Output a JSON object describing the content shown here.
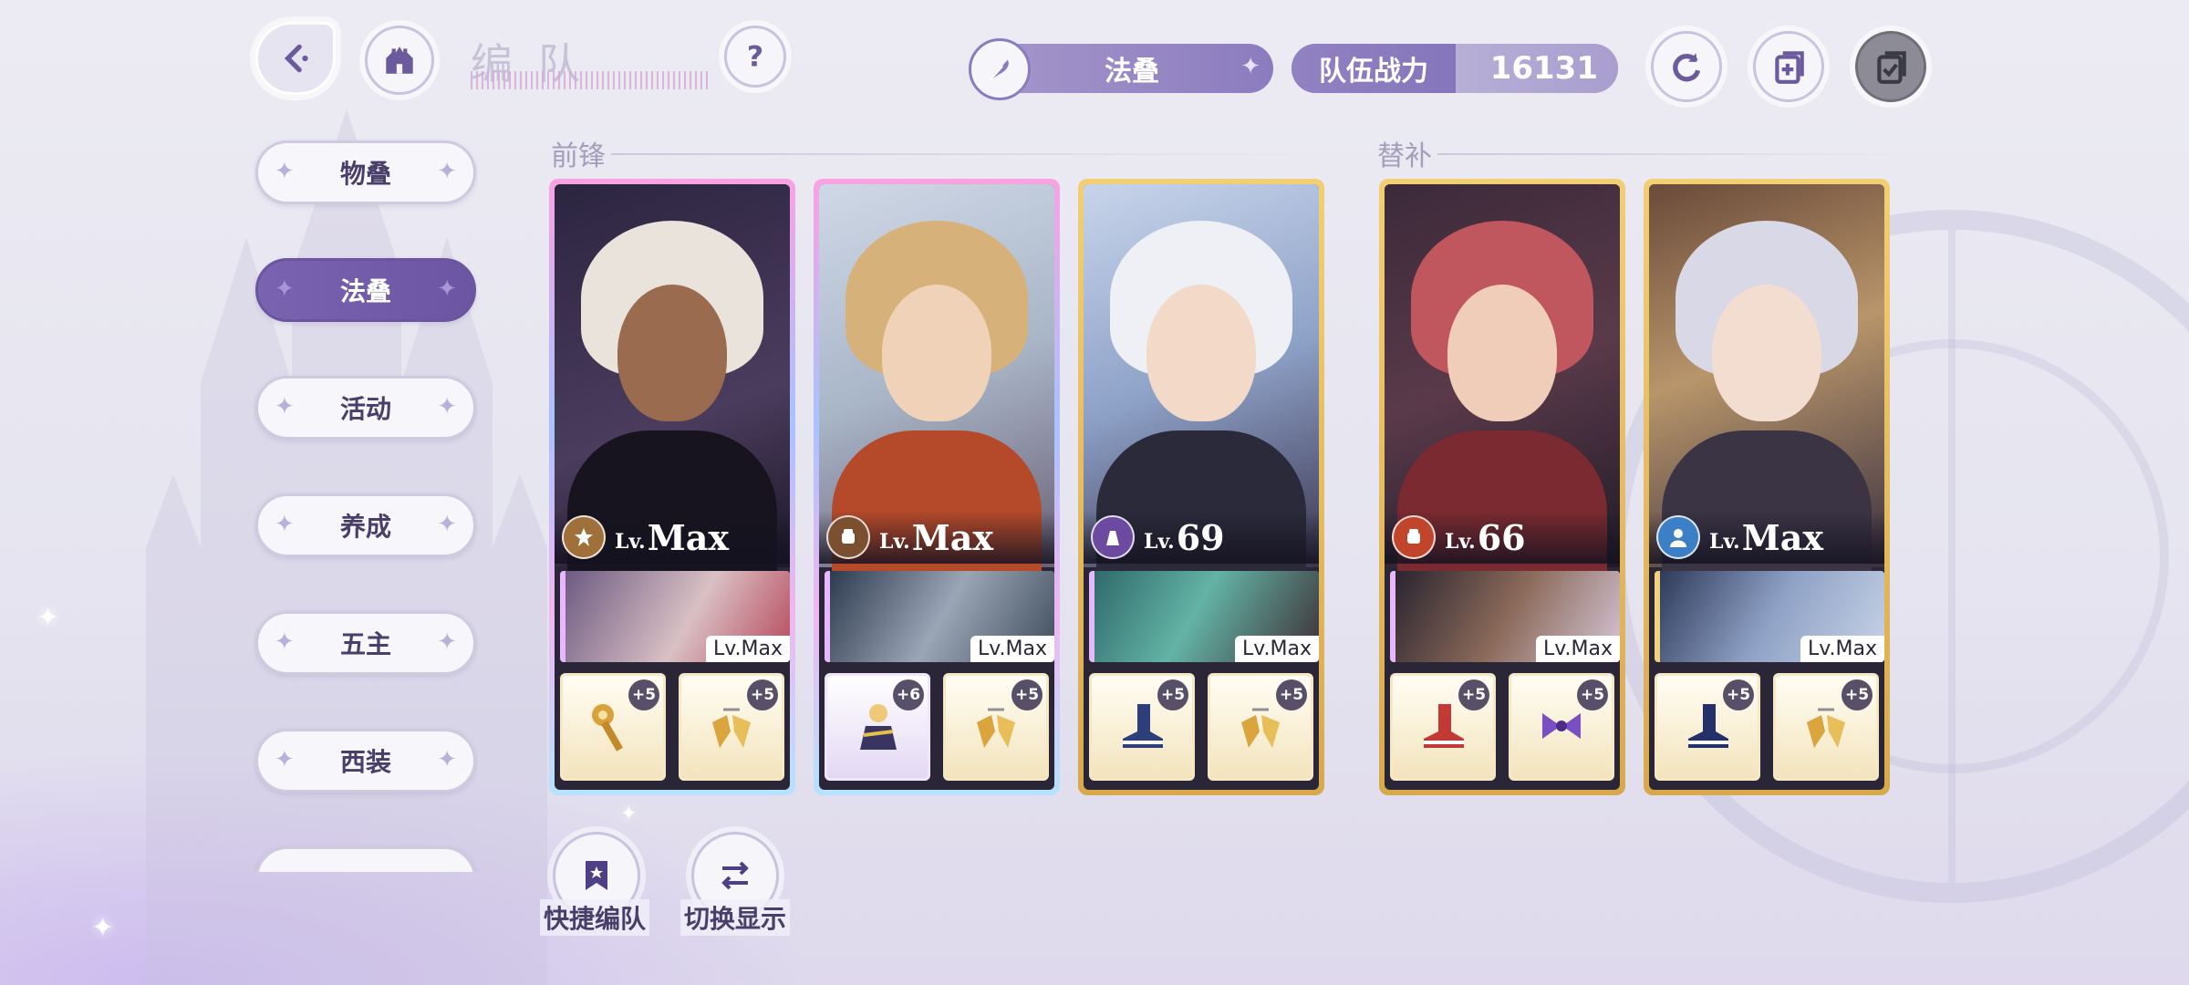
{
  "header": {
    "title": "编队",
    "team_name": "法叠",
    "power_label": "队伍战力",
    "power_value": "16131"
  },
  "menu": {
    "items": [
      {
        "label": "物叠",
        "active": false
      },
      {
        "label": "法叠",
        "active": true
      },
      {
        "label": "活动",
        "active": false
      },
      {
        "label": "养成",
        "active": false
      },
      {
        "label": "五主",
        "active": false
      },
      {
        "label": "西装",
        "active": false
      }
    ]
  },
  "sections": {
    "front": "前锋",
    "sub": "替补"
  },
  "cards": [
    {
      "lv_prefix": "Lv.",
      "level": "Max",
      "class_color": "#a0703a",
      "sub_level": "Lv.Max",
      "items": [
        {
          "icon": "golden-key-icon",
          "plus": "+5"
        },
        {
          "icon": "gold-crystal-icon",
          "plus": "+5"
        }
      ]
    },
    {
      "lv_prefix": "Lv.",
      "level": "Max",
      "class_color": "#7a5030",
      "sub_level": "Lv.Max",
      "items": [
        {
          "icon": "charm-doll-icon",
          "plus": "+6"
        },
        {
          "icon": "gold-crystal-icon",
          "plus": "+5"
        }
      ]
    },
    {
      "lv_prefix": "Lv.",
      "level": "69",
      "class_color": "#6b4aa0",
      "sub_level": "Lv.Max",
      "items": [
        {
          "icon": "blue-boot-icon",
          "plus": "+5"
        },
        {
          "icon": "gold-crystal-icon",
          "plus": "+5"
        }
      ]
    },
    {
      "lv_prefix": "Lv.",
      "level": "66",
      "class_color": "#c0452a",
      "sub_level": "Lv.Max",
      "items": [
        {
          "icon": "red-boot-icon",
          "plus": "+5"
        },
        {
          "icon": "purple-bow-icon",
          "plus": "+5"
        }
      ]
    },
    {
      "lv_prefix": "Lv.",
      "level": "Max",
      "class_color": "#3d7fc4",
      "sub_level": "Lv.Max",
      "items": [
        {
          "icon": "blue-boot-icon",
          "plus": "+5"
        },
        {
          "icon": "gold-crystal-icon",
          "plus": "+5"
        }
      ]
    }
  ],
  "bottom": {
    "quick_label": "快捷编队",
    "toggle_label": "切换显示"
  }
}
